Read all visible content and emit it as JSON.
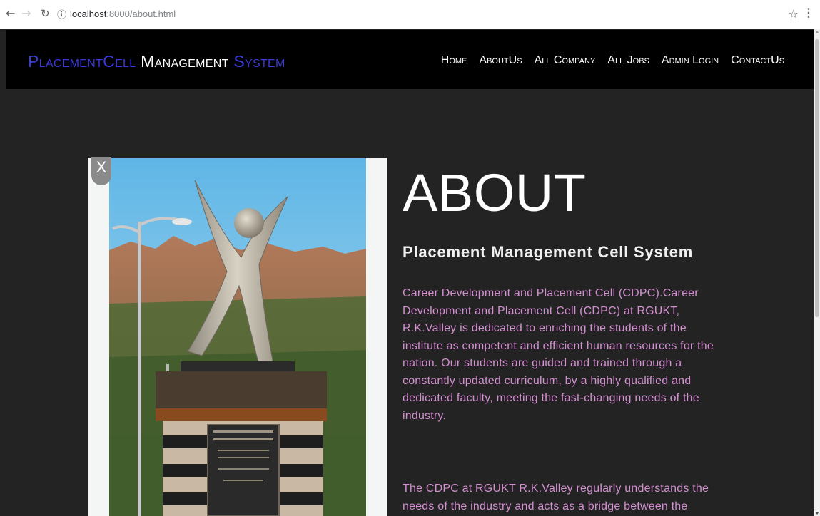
{
  "browser": {
    "url_host": "localhost",
    "url_path": ":8000/about.html"
  },
  "brand": {
    "part1": "PlacementCell",
    "part2": "Management",
    "part3": "System"
  },
  "nav": [
    "Home",
    "AboutUs",
    "All Company",
    "All Jobs",
    "Admin Login",
    "ContactUs"
  ],
  "photo": {
    "close_label": "X"
  },
  "about": {
    "title": "ABOUT",
    "subtitle": "Placement Management Cell System",
    "paragraph1": "Career Development and Placement Cell (CDPC).Career Development and Placement Cell (CDPC) at RGUKT, R.K.Valley is dedicated to enriching the students of the institute as competent and efficient human resources for the nation. Our students are guided and trained through a constantly updated curriculum, by a highly qualified and dedicated faculty, meeting the fast-changing needs of the industry.",
    "paragraph2": "The CDPC at RGUKT R.K.Valley regularly understands the needs of the industry and acts as a bridge between the"
  },
  "colors": {
    "brand_accent": "#3a3ad8",
    "paragraph_text": "#d38fd0",
    "page_background": "#232323",
    "header_background": "#000000"
  }
}
